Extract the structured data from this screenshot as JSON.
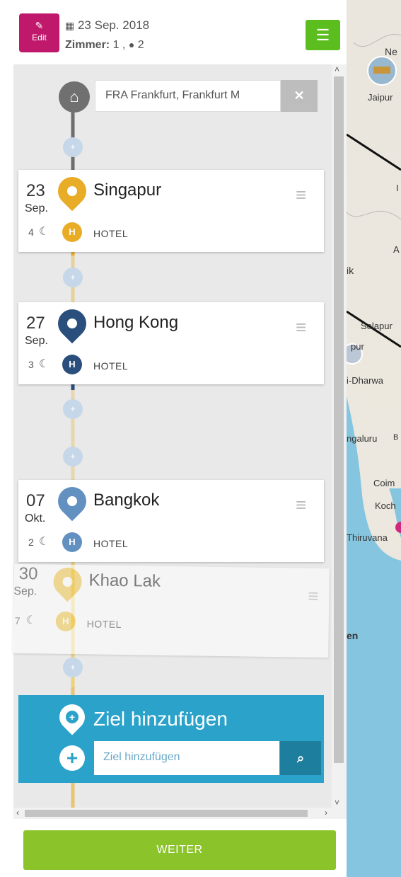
{
  "header": {
    "edit_label": "Edit",
    "date": "23 Sep. 2018",
    "rooms_label": "Zimmer:",
    "rooms_value": "1 ,",
    "persons": "2"
  },
  "origin": {
    "value": "FRA Frankfurt, Frankfurt M"
  },
  "stops": [
    {
      "day": "23",
      "month": "Sep.",
      "city": "Singapur",
      "nights": "4",
      "hotel": "HOTEL",
      "color": "#e8ac26"
    },
    {
      "day": "27",
      "month": "Sep.",
      "city": "Hong Kong",
      "nights": "3",
      "hotel": "HOTEL",
      "color": "#2a4f7c"
    },
    {
      "day": "07",
      "month": "Okt.",
      "city": "Bangkok",
      "nights": "2",
      "hotel": "HOTEL",
      "color": "#6290c0"
    },
    {
      "day": "30",
      "month": "Sep.",
      "city": "Khao Lak",
      "nights": "7",
      "hotel": "HOTEL",
      "color": "#f2c84a"
    }
  ],
  "add_destination": {
    "title": "Ziel hinzufügen",
    "placeholder": "Ziel hinzufügen"
  },
  "map_labels": [
    "Ne",
    "Jaipur",
    "Solapur",
    "pur",
    "i-Dharwa",
    "ngaluru",
    "B",
    "Coim",
    "Koch",
    "Thiruvana",
    "en",
    "ik",
    "A",
    "I"
  ],
  "footer": {
    "button_label": "WEITER"
  },
  "colors": {
    "accent_green": "#8bc32a",
    "edit_magenta": "#c0186b",
    "add_blue": "#2aa2c9"
  }
}
